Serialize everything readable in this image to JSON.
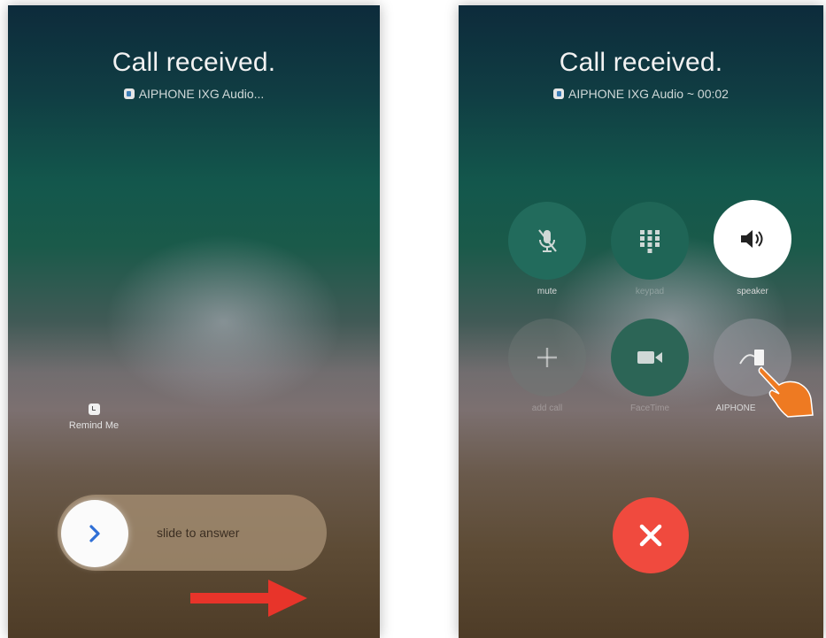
{
  "left_screen": {
    "title": "Call received.",
    "subtitle": "AIPHONE IXG Audio...",
    "app_icon": "app-icon",
    "remind_label": "Remind Me",
    "remind_icon": "clock-icon",
    "slider_label": "slide to answer",
    "slider_icon": "chevron-right-icon",
    "annotation_icon": "red-arrow-right"
  },
  "right_screen": {
    "title": "Call received.",
    "subtitle": "AIPHONE IXG Audio ~ 00:02",
    "app_icon": "app-icon",
    "controls": [
      {
        "label": "mute",
        "icon": "mic-muted-icon"
      },
      {
        "label": "keypad",
        "icon": "keypad-icon"
      },
      {
        "label": "speaker",
        "icon": "speaker-icon"
      },
      {
        "label": "add call",
        "icon": "plus-icon"
      },
      {
        "label": "FaceTime",
        "icon": "video-camera-icon"
      },
      {
        "label": "AIPHONE",
        "icon": "aiphone-icon"
      }
    ],
    "end_call_icon": "close-icon",
    "annotation_icon": "pointing-hand-icon"
  },
  "colors": {
    "end_call": "#f04a3e",
    "arrow": "#e8342a",
    "hand": "#ee7a22",
    "slider_chevron": "#2f6fd6",
    "button_bg": "#226b5c",
    "speaker_active_bg": "#ffffff"
  }
}
